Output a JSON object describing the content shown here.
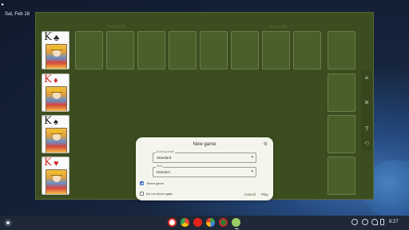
{
  "desktop": {
    "date": "Sat, Feb 18",
    "icons": {
      "screen_capture": "screen-capture-icon",
      "menu_arrow": "cursor-arrow-icon"
    }
  },
  "app": {
    "time": "Time 00:31",
    "score": "Score 400",
    "colors": {
      "felt": "#3c4e1f",
      "slot": "#4a5f29"
    },
    "kings": [
      {
        "rank": "K",
        "suit": "♣",
        "color": "black"
      },
      {
        "rank": "K",
        "suit": "♦",
        "color": "red"
      },
      {
        "rank": "K",
        "suit": "♠",
        "color": "black"
      },
      {
        "rank": "K",
        "suit": "♥",
        "color": "red"
      }
    ],
    "side_rail": {
      "icons": [
        "menu-icon",
        "close-icon",
        "help-icon",
        "undo-icon"
      ],
      "glyphs": [
        "≡",
        "✕",
        "?",
        "⟲"
      ]
    }
  },
  "dialog": {
    "title": "New game",
    "settings_icon": "settings-icon",
    "scoring": {
      "label": "Scoring mode",
      "value": "Standard"
    },
    "deal": {
      "label": "Deal",
      "value": "Random"
    },
    "timed": {
      "label": "Timed game",
      "checked": true
    },
    "dont_show": {
      "label": "Do not show again",
      "checked": false
    },
    "cancel_label": "Cancel",
    "play_label": "Play"
  },
  "shelf": {
    "apps": [
      "gmail-icon",
      "chrome-icon",
      "youtube-icon",
      "play-store-icon",
      "solitaire-icon",
      "android-app-icon"
    ],
    "tray": [
      "screen-record-icon",
      "vpn-icon",
      "wifi-icon",
      "battery-icon"
    ],
    "time": "8:27"
  }
}
